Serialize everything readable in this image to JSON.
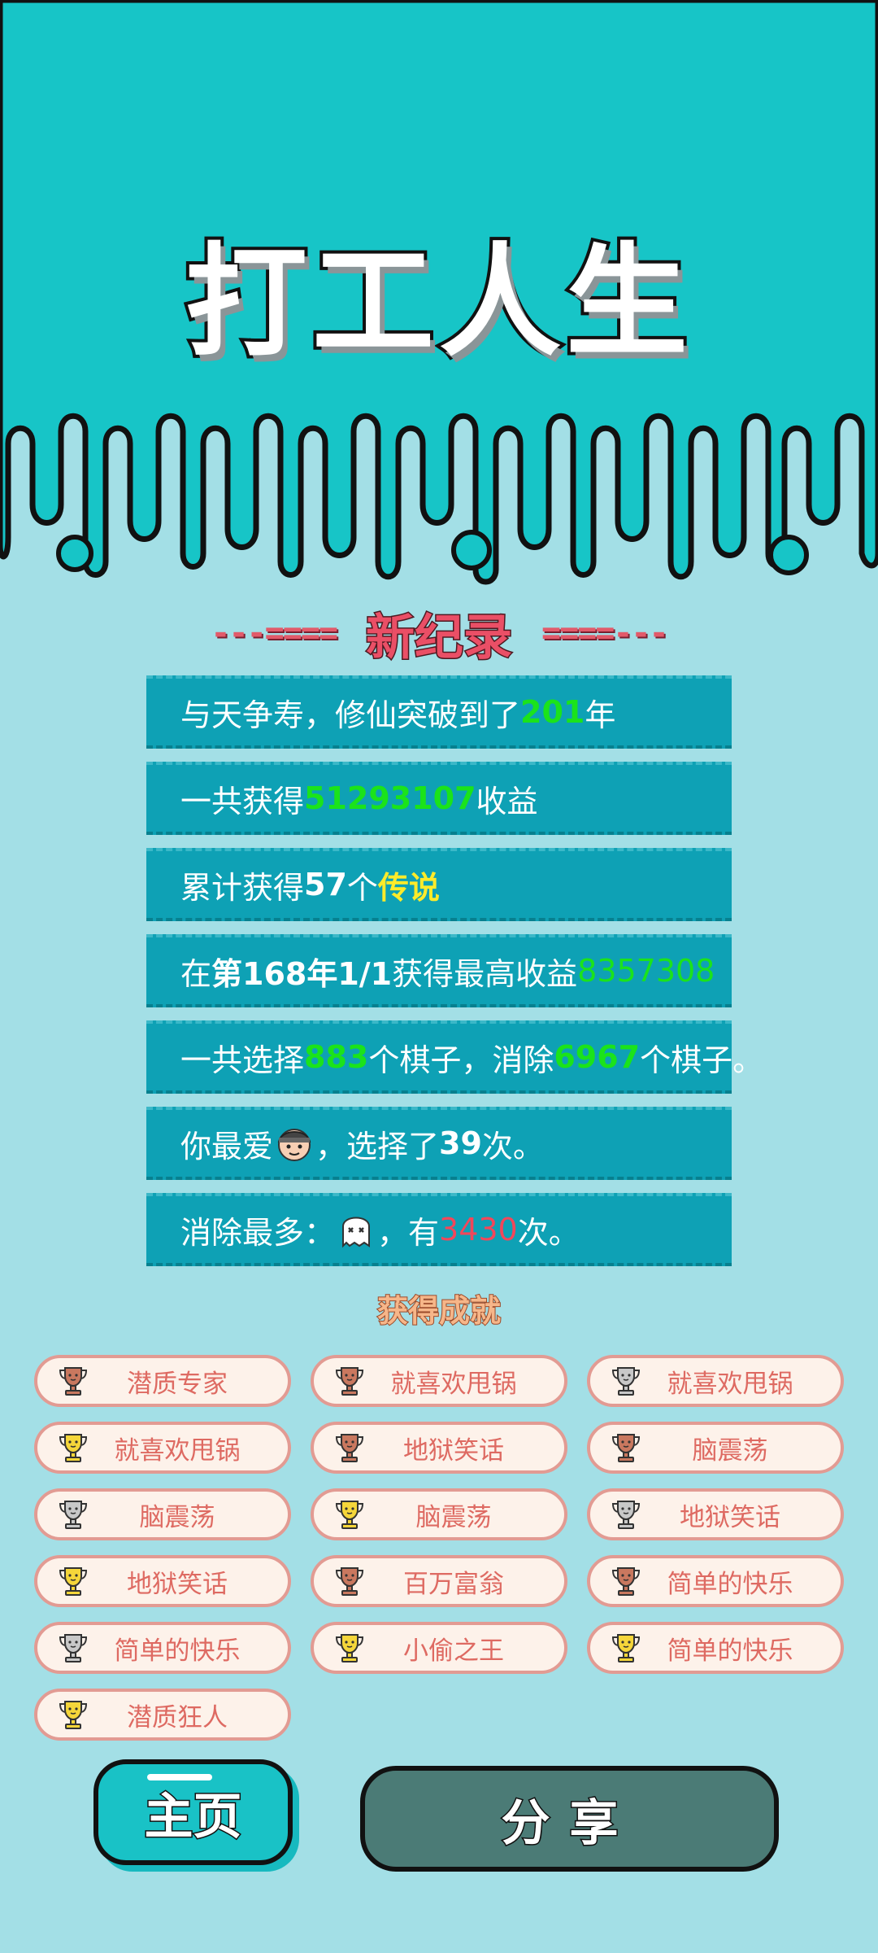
{
  "title": "打工人生",
  "record_title": "新纪录",
  "record_dash_left": "---====",
  "record_dash_right": "====---",
  "stats": {
    "s1": {
      "pre": "与天争寿，修仙突破到了",
      "num": "201",
      "post": "年"
    },
    "s2": {
      "pre": "一共获得",
      "num": "51293107",
      "post": "收益"
    },
    "s3": {
      "pre": "累计获得",
      "num": "57",
      "mid": "个",
      "tag": "传说"
    },
    "s4": {
      "pre": "在 ",
      "date": "第168年1/1",
      "mid": " 获得最高收益",
      "num": "8357308"
    },
    "s5": {
      "pre": "一共选择",
      "num1": "883",
      "mid": "个棋子，消除",
      "num2": "6967",
      "post": "个棋子。"
    },
    "s6": {
      "pre": "你最爱",
      "icon": "thief-face-icon",
      "mid": "，选择了",
      "num": "39",
      "post": "次。"
    },
    "s7": {
      "pre": "消除最多：",
      "icon": "ghost-icon",
      "mid": "，有",
      "num": "3430",
      "post": "次。"
    }
  },
  "achievements_title": "获得成就",
  "achievements": [
    {
      "label": "潜质专家",
      "tier": "bronze"
    },
    {
      "label": "就喜欢甩锅",
      "tier": "bronze"
    },
    {
      "label": "就喜欢甩锅",
      "tier": "silver"
    },
    {
      "label": "就喜欢甩锅",
      "tier": "gold"
    },
    {
      "label": "地狱笑话",
      "tier": "bronze"
    },
    {
      "label": "脑震荡",
      "tier": "bronze"
    },
    {
      "label": "脑震荡",
      "tier": "silver"
    },
    {
      "label": "脑震荡",
      "tier": "gold"
    },
    {
      "label": "地狱笑话",
      "tier": "silver"
    },
    {
      "label": "地狱笑话",
      "tier": "gold"
    },
    {
      "label": "百万富翁",
      "tier": "bronze"
    },
    {
      "label": "简单的快乐",
      "tier": "bronze"
    },
    {
      "label": "简单的快乐",
      "tier": "silver"
    },
    {
      "label": "小偷之王",
      "tier": "gold"
    },
    {
      "label": "简单的快乐",
      "tier": "gold"
    },
    {
      "label": "潜质狂人",
      "tier": "gold"
    }
  ],
  "tier_colors": {
    "bronze": "#c9785f",
    "silver": "#c8c8c8",
    "gold": "#f5d63a"
  },
  "buttons": {
    "home": "主页",
    "share": "分享"
  }
}
